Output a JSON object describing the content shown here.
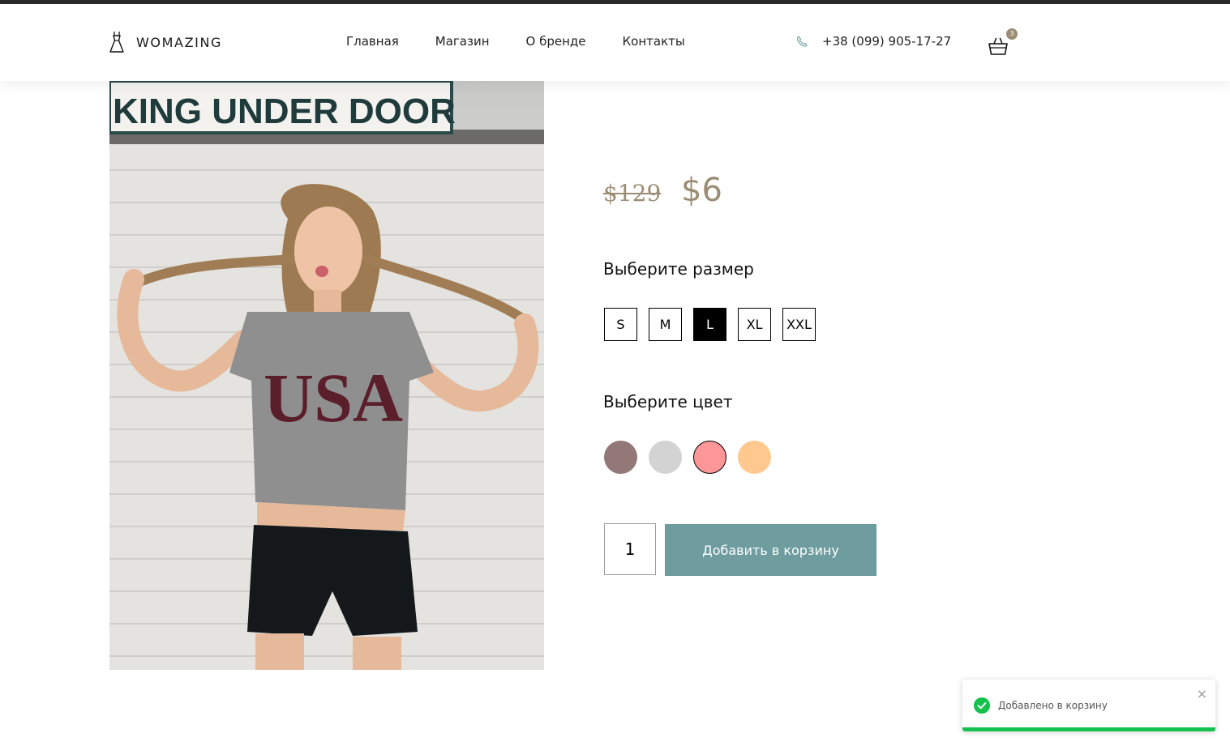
{
  "header": {
    "logo_text": "WOMAZING",
    "nav": [
      "Главная",
      "Магазин",
      "О бренде",
      "Контакты"
    ],
    "phone": "+38 (099) 905-17-27",
    "cart_count": "3"
  },
  "product": {
    "image_sign_text": "KING UNDER DOOR",
    "shirt_text": "USA",
    "price_old": "$129",
    "price_new": "$6",
    "size_label": "Выберите размер",
    "sizes": [
      "S",
      "M",
      "L",
      "XL",
      "XXL"
    ],
    "selected_size": "L",
    "color_label": "Выберите цвет",
    "colors": [
      "#927876",
      "#d3d3d3",
      "#fd9696",
      "#ffc88f"
    ],
    "selected_color": "#fd9696",
    "quantity": "1",
    "add_to_cart_label": "Добавить в корзину"
  },
  "toast": {
    "message": "Добавлено в корзину",
    "close_symbol": "×",
    "progress": 1.0,
    "accent": "#13c14c"
  },
  "colors": {
    "accent": "#9b8c74",
    "button": "#6e9c9f"
  },
  "icons": {
    "logo": "dress-icon",
    "phone": "phone-icon",
    "cart": "shopping-basket-icon",
    "toast": "check-circle-icon"
  }
}
